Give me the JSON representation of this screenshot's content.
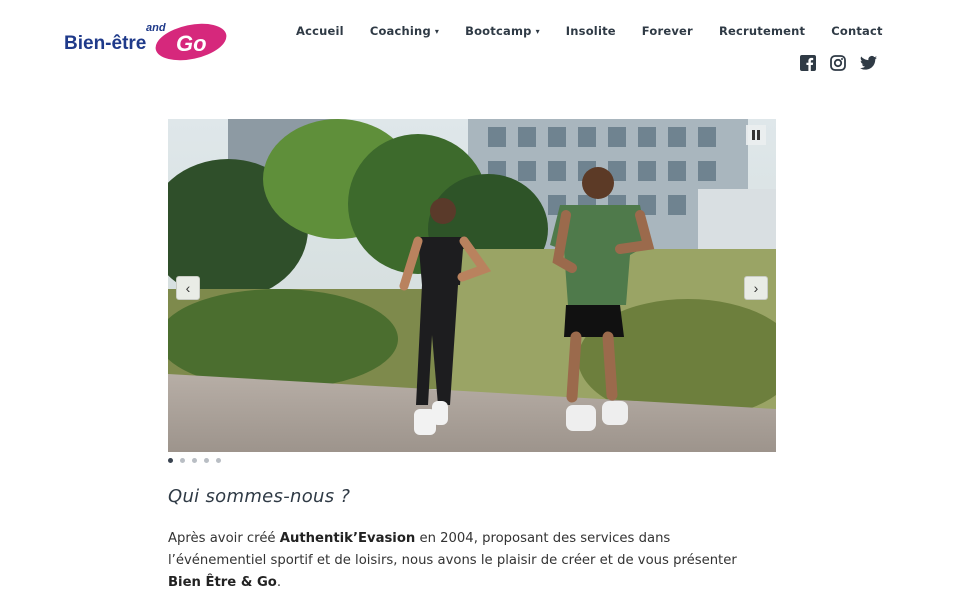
{
  "logo": {
    "text_main": "Bien-être",
    "text_small": "and",
    "text_go": "Go"
  },
  "nav": {
    "items": [
      {
        "label": "Accueil",
        "dropdown": false
      },
      {
        "label": "Coaching",
        "dropdown": true
      },
      {
        "label": "Bootcamp",
        "dropdown": true
      },
      {
        "label": "Insolite",
        "dropdown": false
      },
      {
        "label": "Forever",
        "dropdown": false
      },
      {
        "label": "Recrutement",
        "dropdown": false
      },
      {
        "label": "Contact",
        "dropdown": false
      }
    ],
    "caret": "▾"
  },
  "social": [
    "facebook-icon",
    "instagram-icon",
    "twitter-icon"
  ],
  "slider": {
    "prev": "‹",
    "next": "›",
    "slide_count": 5,
    "active_index": 0
  },
  "content": {
    "heading": "Qui sommes-nous ?",
    "para_1": "Après avoir créé ",
    "para_bold_1": "Authentik’Evasion",
    "para_2": " en 2004, proposant des services dans l’événementiel sportif et de loisirs, nous avons le plaisir de créer et de vous présenter ",
    "para_bold_2": "Bien Être & Go",
    "para_3": "."
  },
  "colors": {
    "brand_blue": "#1f3a8a",
    "brand_pink": "#d6287c",
    "nav_text": "#2f3a45"
  }
}
